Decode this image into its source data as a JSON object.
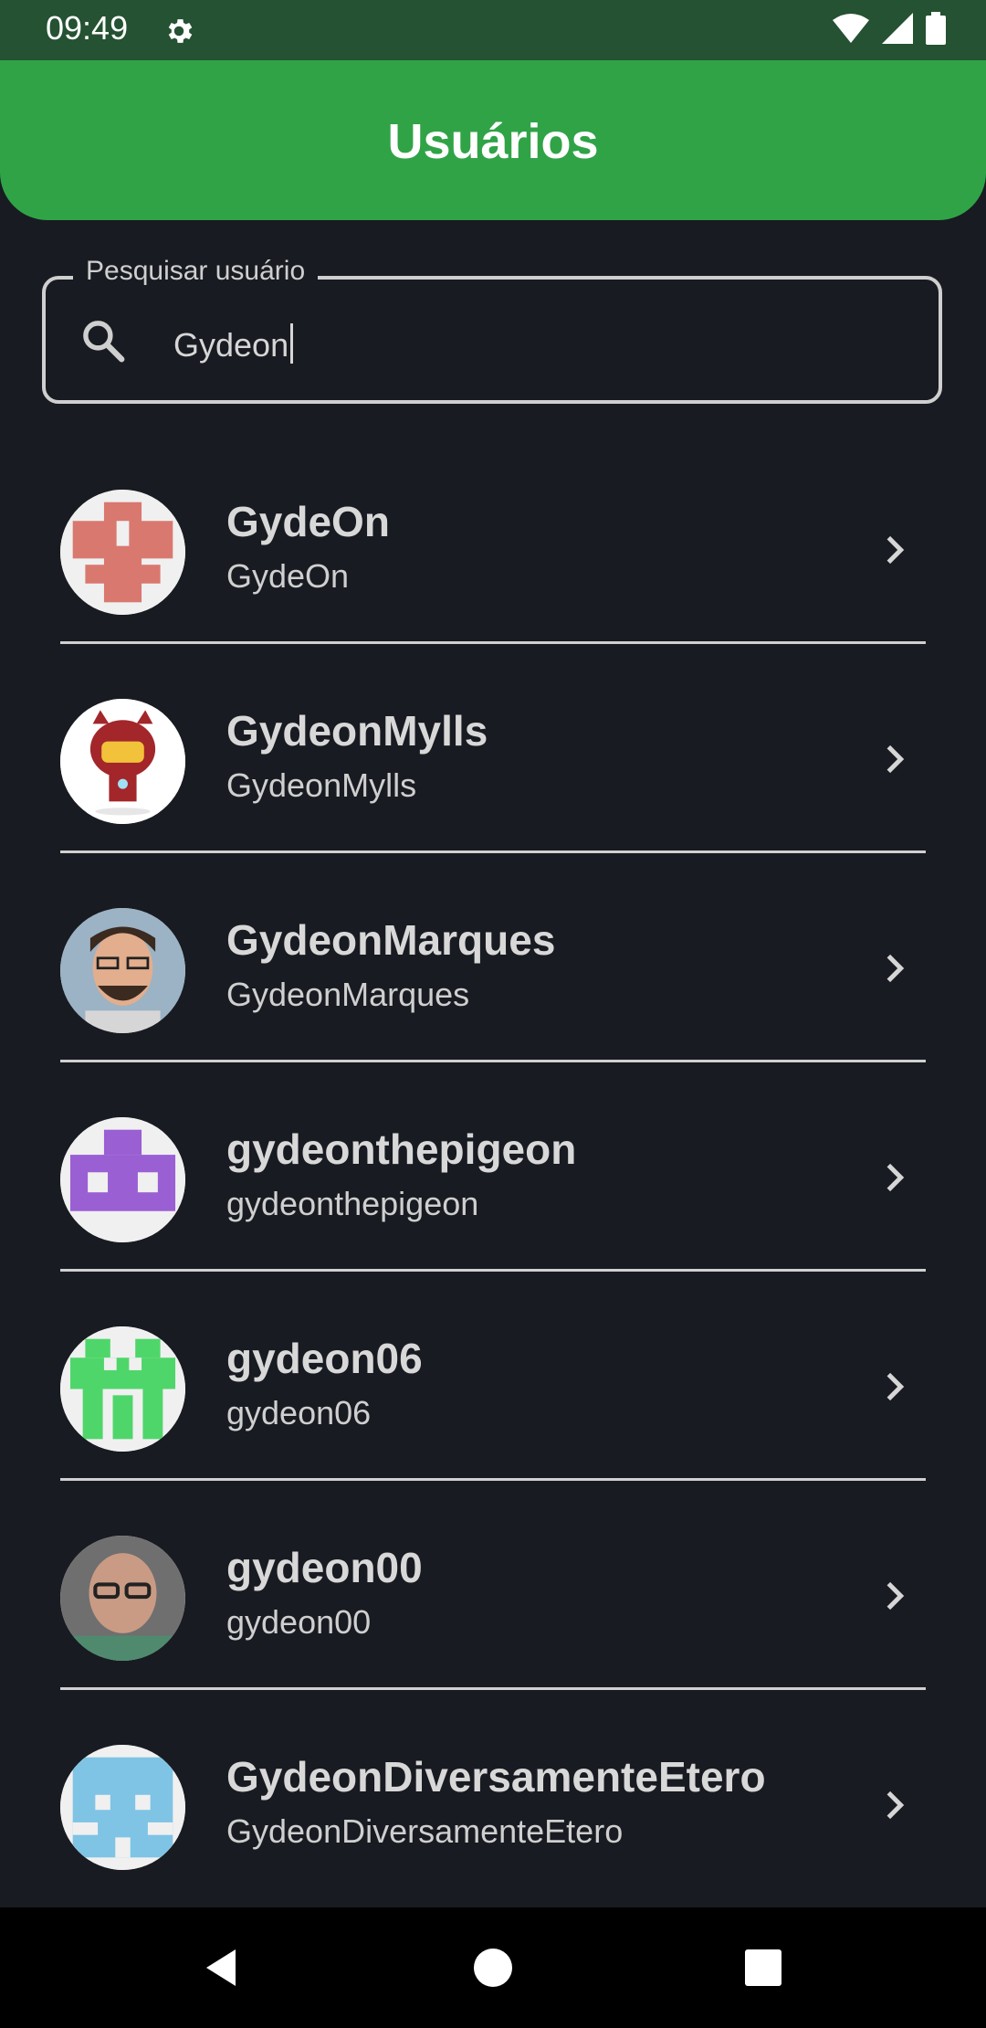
{
  "status": {
    "time": "09:49"
  },
  "app_bar": {
    "title": "Usuários"
  },
  "search": {
    "label": "Pesquisar usuário",
    "value": "Gydeon"
  },
  "users": [
    {
      "name": "GydeOn",
      "login": "GydeOn"
    },
    {
      "name": "GydeonMylls",
      "login": "GydeonMylls"
    },
    {
      "name": "GydeonMarques",
      "login": "GydeonMarques"
    },
    {
      "name": "gydeonthepigeon",
      "login": "gydeonthepigeon"
    },
    {
      "name": "gydeon06",
      "login": "gydeon06"
    },
    {
      "name": "gydeon00",
      "login": "gydeon00"
    },
    {
      "name": "GydeonDiversamenteEtero",
      "login": "GydeonDiversamenteEtero"
    }
  ],
  "colors": {
    "accent": "#30a347",
    "status_bar": "#245232",
    "background": "#181b21"
  }
}
